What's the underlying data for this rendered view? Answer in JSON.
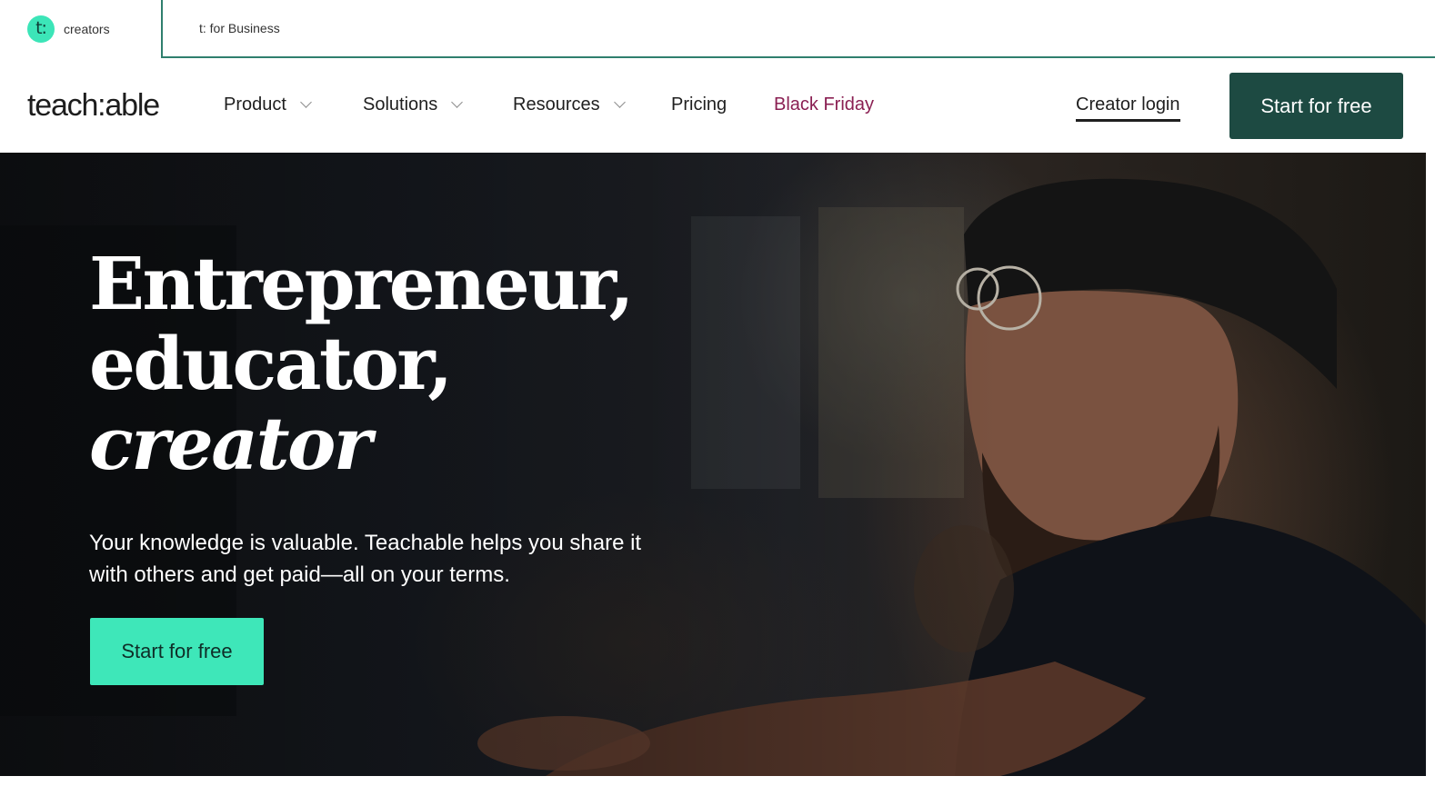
{
  "switcher": {
    "creators_badge": "t:",
    "creators_label": "creators",
    "business_label": "t: for Business"
  },
  "nav": {
    "logo": "teach:able",
    "items": [
      {
        "label": "Product",
        "has_dropdown": true
      },
      {
        "label": "Solutions",
        "has_dropdown": true
      },
      {
        "label": "Resources",
        "has_dropdown": true
      },
      {
        "label": "Pricing",
        "has_dropdown": false
      },
      {
        "label": "Black Friday",
        "has_dropdown": false
      }
    ],
    "login_label": "Creator login",
    "cta_label": "Start for free"
  },
  "hero": {
    "headline_line1": "Entrepreneur,",
    "headline_line2": "educator,",
    "headline_line3": "creator",
    "subhead": "Your knowledge is valuable. Teachable helps you share it with others and get paid—all on your terms.",
    "cta_label": "Start for free"
  },
  "colors": {
    "brand_dark": "#1d4a42",
    "brand_mint": "#3ee7b9",
    "promo": "#8a1f52",
    "switcher_border": "#2f7f6e"
  },
  "icons": [
    "chevron-down-icon"
  ]
}
